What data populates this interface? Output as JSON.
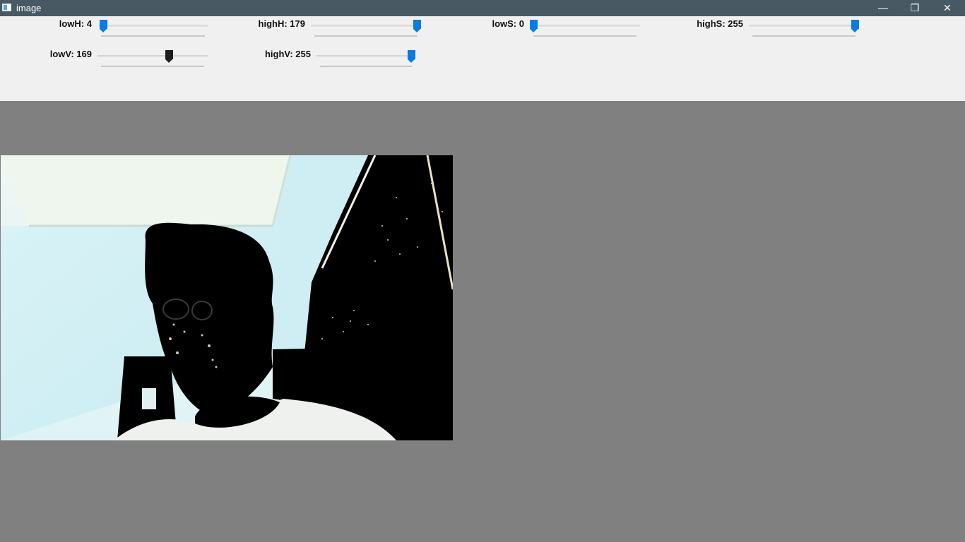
{
  "window": {
    "title": "image",
    "minimize_glyph": "—",
    "restore_glyph": "❐",
    "close_glyph": "✕"
  },
  "trackbars": [
    {
      "name": "lowH",
      "label": "lowH:",
      "value": "4",
      "max": 179
    },
    {
      "name": "highH",
      "label": "highH:",
      "value": "179",
      "max": 179
    },
    {
      "name": "lowS",
      "label": "lowS:",
      "value": "0",
      "max": 255
    },
    {
      "name": "highS",
      "label": "highS:",
      "value": "255",
      "max": 255
    },
    {
      "name": "lowV",
      "label": "lowV:",
      "value": "169",
      "max": 255
    },
    {
      "name": "highV",
      "label": "highV:",
      "value": "255",
      "max": 255
    }
  ],
  "colors": {
    "titlebar": "#495963",
    "panel": "#f0f0f0",
    "canvas": "#808080",
    "thumb_active": "#0a7be0",
    "thumb_focused": "#1d1d1d"
  }
}
